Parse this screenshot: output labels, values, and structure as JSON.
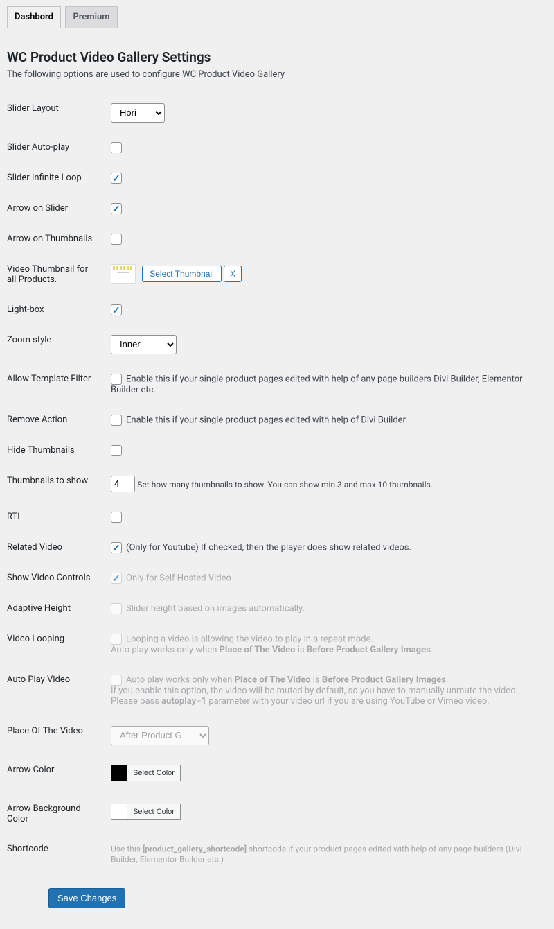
{
  "tabs": {
    "dashboard": "Dashbord",
    "premium": "Premium"
  },
  "page": {
    "title": "WC Product Video Gallery Settings",
    "desc": "The following options are used to configure WC Product Video Gallery"
  },
  "fields": {
    "slider_layout": {
      "label": "Slider Layout",
      "value": "Horizontal"
    },
    "slider_autoplay": {
      "label": "Slider Auto-play"
    },
    "slider_loop": {
      "label": "Slider Infinite Loop"
    },
    "arrow_slider": {
      "label": "Arrow on Slider"
    },
    "arrow_thumbs": {
      "label": "Arrow on Thumbnails"
    },
    "video_thumb": {
      "label": "Video Thumbnail for all Products.",
      "btn_select": "Select Thumbnail",
      "btn_x": "X"
    },
    "lightbox": {
      "label": "Light-box"
    },
    "zoom": {
      "label": "Zoom style",
      "value": "Inner"
    },
    "template_filter": {
      "label": "Allow Template Filter",
      "hint": "Enable this if your single product pages edited with help of any page builders Divi Builder, Elementor Builder etc."
    },
    "remove_action": {
      "label": "Remove Action",
      "hint": "Enable this if your single product pages edited with help of Divi Builder."
    },
    "hide_thumbs": {
      "label": "Hide Thumbnails"
    },
    "thumbs_to_show": {
      "label": "Thumbnails to show",
      "value": "4",
      "hint": "Set how many thumbnails to show. You can show min 3 and max 10 thumbnails."
    },
    "rtl": {
      "label": "RTL"
    },
    "related_video": {
      "label": "Related Video",
      "hint": "(Only for Youtube) If checked, then the player does show related videos."
    },
    "show_controls": {
      "label": "Show Video Controls",
      "hint": "Only for Self Hosted Video"
    },
    "adaptive_height": {
      "label": "Adaptive Height",
      "hint": "Slider height based on images automatically."
    },
    "video_looping": {
      "label": "Video Looping",
      "hint1": "Looping a video is allowing the video to play in a repeat mode.",
      "hint2a": "Auto play works only when ",
      "hint2b": "Place of The Video",
      "hint2c": " is ",
      "hint2d": "Before Product Gallery Images",
      "hint2e": "."
    },
    "autoplay_video": {
      "label": "Auto Play Video",
      "l1a": "Auto play works only when ",
      "l1b": "Place of The Video",
      "l1c": " is ",
      "l1d": "Before Product Gallery Images",
      "l1e": ".",
      "l2": "If you enable this option, the video will be muted by default, so you have to manually unmute the video.",
      "l3a": "Please pass ",
      "l3b": "autoplay=1",
      "l3c": " parameter with your video url if you are using YouTube or Vimeo video."
    },
    "place_video": {
      "label": "Place Of The Video",
      "value": "After Product Gallery Images"
    },
    "arrow_color": {
      "label": "Arrow Color",
      "btn": "Select Color"
    },
    "arrow_bg_color": {
      "label": "Arrow Background Color",
      "btn": "Select Color"
    },
    "shortcode": {
      "label": "Shortcode",
      "pre": "Use this ",
      "code": "[product_gallery_shortcode]",
      "post": " shortcode if your product pages edited with help of any page builders (Divi Builder, Elementor Builder etc.)"
    }
  },
  "submit": {
    "label": "Save Changes"
  }
}
